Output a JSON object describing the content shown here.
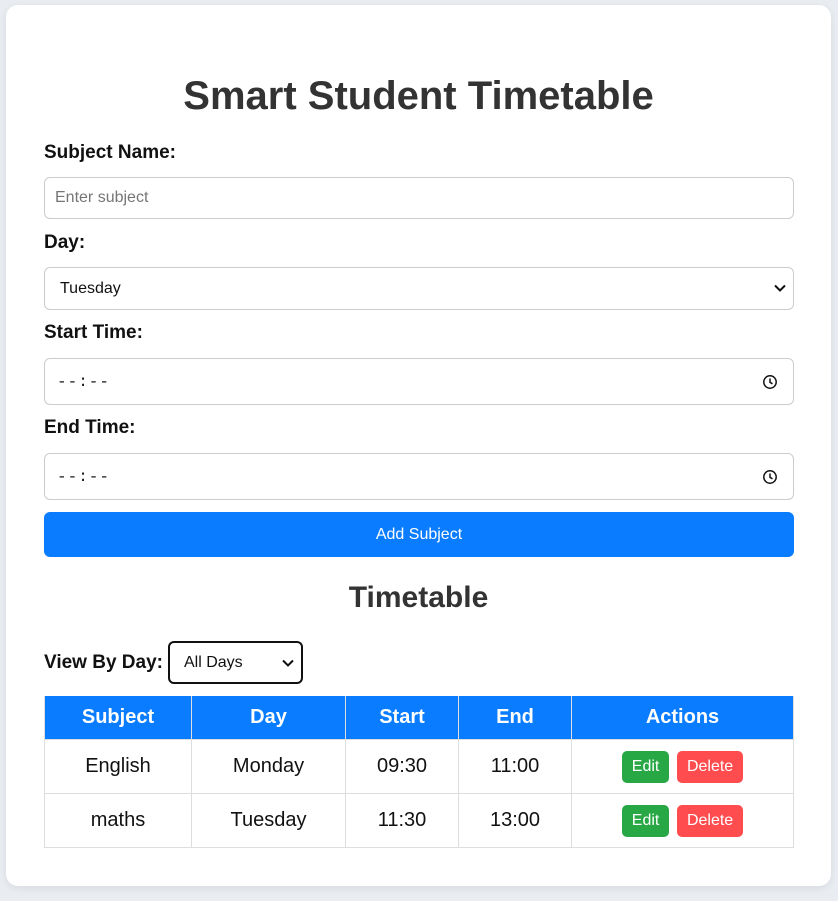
{
  "page": {
    "title": "Smart Student Timetable"
  },
  "form": {
    "subject_label": "Subject Name:",
    "subject_placeholder": "Enter subject",
    "subject_value": "",
    "day_label": "Day:",
    "day_value": "Tuesday",
    "start_label": "Start Time:",
    "start_value": "--:--",
    "end_label": "End Time:",
    "end_value": "--:--",
    "add_button": "Add Subject"
  },
  "timetable": {
    "heading": "Timetable",
    "view_by_label": "View By Day:",
    "view_by_value": "All Days",
    "columns": [
      "Subject",
      "Day",
      "Start",
      "End",
      "Actions"
    ],
    "rows": [
      {
        "subject": "English",
        "day": "Monday",
        "start": "09:30",
        "end": "11:00",
        "edit": "Edit",
        "delete": "Delete"
      },
      {
        "subject": "maths",
        "day": "Tuesday",
        "start": "11:30",
        "end": "13:00",
        "edit": "Edit",
        "delete": "Delete"
      }
    ]
  },
  "colors": {
    "primary": "#0a7cff",
    "edit": "#28a745",
    "delete": "#ff4d4f"
  }
}
